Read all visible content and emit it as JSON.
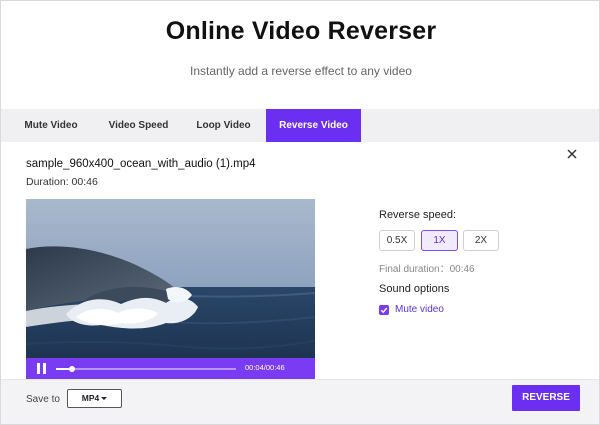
{
  "header": {
    "title": "Online Video Reverser",
    "subtitle": "Instantly add a reverse effect to any video"
  },
  "tabs": [
    {
      "label": "Mute Video",
      "active": false
    },
    {
      "label": "Video Speed",
      "active": false
    },
    {
      "label": "Loop Video",
      "active": false
    },
    {
      "label": "Reverse Video",
      "active": true
    }
  ],
  "file": {
    "name": "sample_960x400_ocean_with_audio (1).mp4",
    "duration": "Duration: 00:46"
  },
  "player": {
    "time": "00:04/00:46",
    "progress": 0.087,
    "state_icon": "pause-icon"
  },
  "options": {
    "reverse_speed_label": "Reverse speed:",
    "speeds": [
      {
        "label": "0.5X",
        "selected": false
      },
      {
        "label": "1X",
        "selected": true
      },
      {
        "label": "2X",
        "selected": false
      }
    ],
    "final_duration": "Final duration：00:46",
    "sound_options_label": "Sound options",
    "mute_label": "Mute video",
    "mute_checked": true
  },
  "footer": {
    "save_to_label": "Save to",
    "format": "MP4",
    "reverse_label": "REVERSE"
  },
  "colors": {
    "accent": "#6a2ff0",
    "accent_light": "#f1ebff"
  }
}
